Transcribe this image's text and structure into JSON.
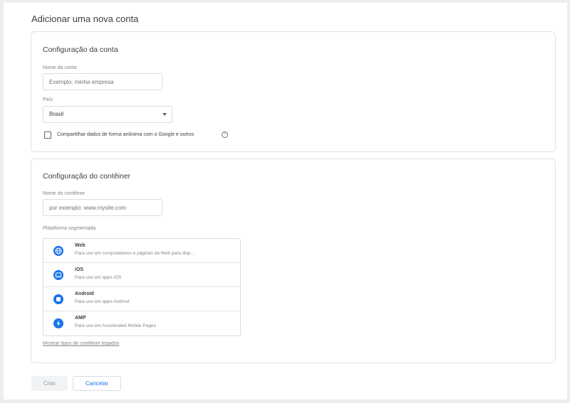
{
  "page": {
    "title": "Adicionar uma nova conta"
  },
  "account": {
    "section_title": "Configuração da conta",
    "name_label": "Nome da conta",
    "name_placeholder": "Exemplo: minha empresa",
    "country_label": "País",
    "country_value": "Brasil",
    "share_label": "Compartilhar dados de forma anônima com o Google e outros",
    "share_checked": false,
    "help_icon": "help-circle-icon"
  },
  "container": {
    "section_title": "Configuração do contêiner",
    "name_label": "Nome do contêiner",
    "name_placeholder": "por exemplo: www.mysite.com",
    "platform_label": "Plataforma segmentada",
    "platforms": [
      {
        "name": "Web",
        "description": "Para uso em computadores e páginas da Web para disp...",
        "icon": "globe-icon"
      },
      {
        "name": "iOS",
        "description": "Para uso em apps iOS",
        "icon": "ios-device-icon"
      },
      {
        "name": "Android",
        "description": "Para uso em apps Android",
        "icon": "android-icon"
      },
      {
        "name": "AMP",
        "description": "Para uso em Accelerated Mobile Pages",
        "icon": "lightning-icon"
      }
    ],
    "legacy_link": "Mostrar tipos de contêiner legados"
  },
  "actions": {
    "create_label": "Criar",
    "cancel_label": "Cancelar"
  },
  "colors": {
    "accent": "#1a73e8",
    "border": "#dadce0",
    "text": "#3c4043",
    "muted": "#80868b"
  }
}
